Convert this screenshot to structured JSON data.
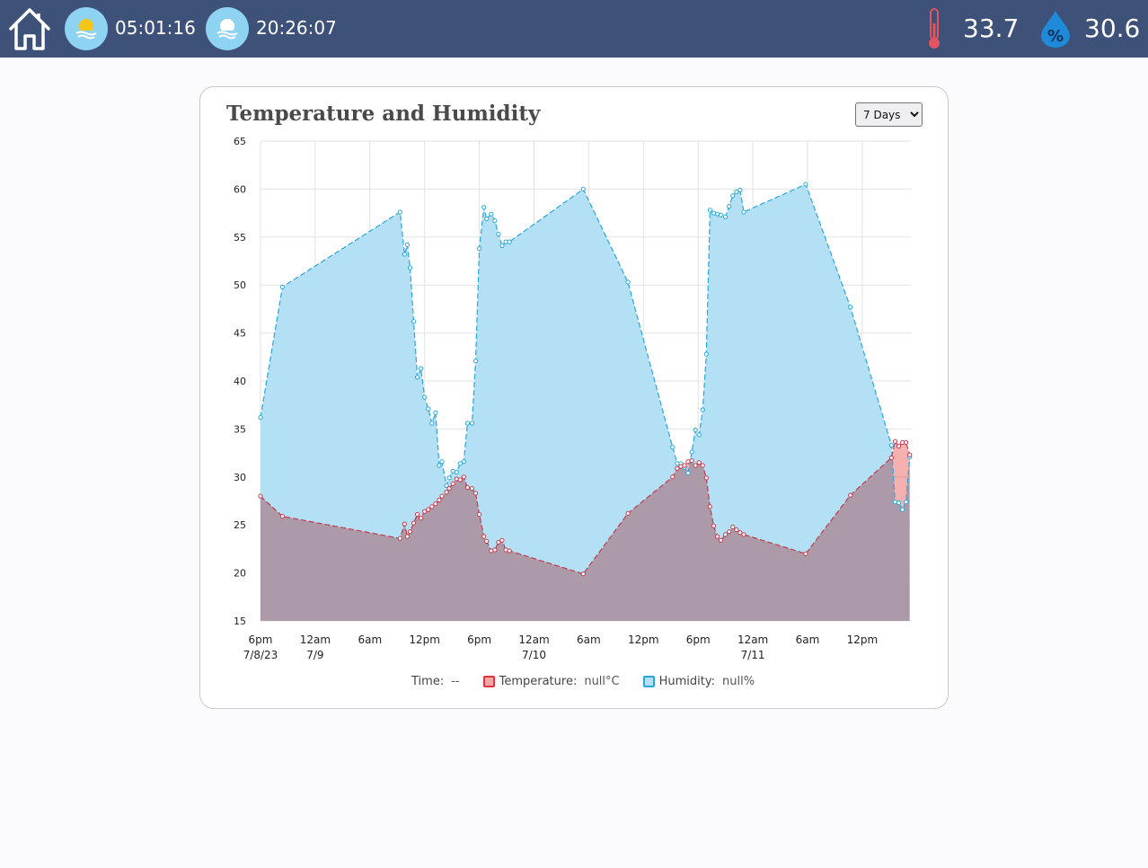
{
  "header": {
    "sunrise_time": "05:01:16",
    "sunset_time": "20:26:07",
    "temperature": "33.7",
    "humidity": "30.6",
    "colors": {
      "bar": "#3e5179",
      "sun_badge": "#8fd3f2",
      "thermometer": "#e05560",
      "drop": "#1e8ad8"
    },
    "icons": [
      "home-icon",
      "sunrise-icon",
      "sunset-icon",
      "thermometer-icon",
      "humidity-drop-icon"
    ]
  },
  "card": {
    "title": "Temperature and Humidity",
    "range_select": {
      "value": "7 Days"
    }
  },
  "legend": {
    "time_label": "Time:",
    "time_value": "--",
    "temperature_label": "Temperature:",
    "temperature_value": "null°C",
    "humidity_label": "Humidity:",
    "humidity_value": "null%"
  },
  "chart_data": {
    "type": "area",
    "title": "",
    "ylim": [
      15,
      65
    ],
    "yticks": [
      15,
      20,
      25,
      30,
      35,
      40,
      45,
      50,
      55,
      60,
      65
    ],
    "xlim": [
      18,
      77.7
    ],
    "x_unit": "hours from 12am 7/8/23",
    "x_ticks": [
      {
        "x": 18,
        "label": "6pm",
        "sub": "7/8/23"
      },
      {
        "x": 24,
        "label": "12am",
        "sub": "7/9"
      },
      {
        "x": 30,
        "label": "6am",
        "sub": ""
      },
      {
        "x": 36,
        "label": "12pm",
        "sub": ""
      },
      {
        "x": 42,
        "label": "6pm",
        "sub": ""
      },
      {
        "x": 48,
        "label": "12am",
        "sub": "7/10"
      },
      {
        "x": 54,
        "label": "6am",
        "sub": ""
      },
      {
        "x": 60,
        "label": "12pm",
        "sub": ""
      },
      {
        "x": 66,
        "label": "6pm",
        "sub": ""
      },
      {
        "x": 72,
        "label": "12am",
        "sub": "7/11"
      },
      {
        "x": 78,
        "label": "6am",
        "sub": ""
      },
      {
        "x": 84,
        "label": "12pm",
        "sub": ""
      }
    ],
    "grid": true,
    "series": [
      {
        "name": "Humidity",
        "color": "#29a7dc",
        "fill": "#b3e0f4",
        "points": [
          [
            18.0,
            36.2
          ],
          [
            20.4,
            49.8
          ],
          [
            33.3,
            57.6
          ],
          [
            33.8,
            53.2
          ],
          [
            34.1,
            54.2
          ],
          [
            34.4,
            51.8
          ],
          [
            34.8,
            46.2
          ],
          [
            35.2,
            40.4
          ],
          [
            35.6,
            41.3
          ],
          [
            36.0,
            38.3
          ],
          [
            36.4,
            37.1
          ],
          [
            36.8,
            35.6
          ],
          [
            37.2,
            36.7
          ],
          [
            37.6,
            31.2
          ],
          [
            37.9,
            31.6
          ],
          [
            38.4,
            29.1
          ],
          [
            38.7,
            29.9
          ],
          [
            39.1,
            30.6
          ],
          [
            39.5,
            30.5
          ],
          [
            39.9,
            31.4
          ],
          [
            40.3,
            31.6
          ],
          [
            40.7,
            35.6
          ],
          [
            41.2,
            35.6
          ],
          [
            41.6,
            42.1
          ],
          [
            42.0,
            53.8
          ],
          [
            42.5,
            58.1
          ],
          [
            42.8,
            56.9
          ],
          [
            43.3,
            57.4
          ],
          [
            43.7,
            56.7
          ],
          [
            44.1,
            55.3
          ],
          [
            44.5,
            54.1
          ],
          [
            44.9,
            54.5
          ],
          [
            45.3,
            54.5
          ],
          [
            53.4,
            60.0
          ],
          [
            58.3,
            50.3
          ],
          [
            63.2,
            33.1
          ],
          [
            63.7,
            31.4
          ],
          [
            64.1,
            31.4
          ],
          [
            64.5,
            31.0
          ],
          [
            64.9,
            30.4
          ],
          [
            65.3,
            32.6
          ],
          [
            65.7,
            34.9
          ],
          [
            66.1,
            34.4
          ],
          [
            66.5,
            37.0
          ],
          [
            66.9,
            42.8
          ],
          [
            67.3,
            57.8
          ],
          [
            67.7,
            57.5
          ],
          [
            68.1,
            57.4
          ],
          [
            68.5,
            57.3
          ],
          [
            69.0,
            57.1
          ],
          [
            69.4,
            58.2
          ],
          [
            69.8,
            59.3
          ],
          [
            70.2,
            59.7
          ],
          [
            70.6,
            59.9
          ],
          [
            71.0,
            57.6
          ],
          [
            77.8,
            60.5
          ],
          [
            82.7,
            47.7
          ],
          [
            87.2,
            33.3
          ],
          [
            87.6,
            27.4
          ],
          [
            88.0,
            27.3
          ],
          [
            88.4,
            26.6
          ],
          [
            88.8,
            27.4
          ],
          [
            89.2,
            32.1
          ]
        ]
      },
      {
        "name": "Temperature",
        "color": "#c23a4e",
        "fill": "#f6a5a5",
        "points": [
          [
            18.0,
            28.0
          ],
          [
            20.4,
            25.9
          ],
          [
            33.3,
            23.6
          ],
          [
            33.8,
            25.1
          ],
          [
            34.1,
            23.8
          ],
          [
            34.4,
            24.3
          ],
          [
            34.8,
            25.2
          ],
          [
            35.2,
            26.1
          ],
          [
            35.6,
            25.7
          ],
          [
            36.0,
            26.4
          ],
          [
            36.4,
            26.6
          ],
          [
            36.8,
            26.9
          ],
          [
            37.2,
            27.2
          ],
          [
            37.6,
            27.6
          ],
          [
            37.9,
            28.0
          ],
          [
            38.4,
            28.4
          ],
          [
            38.7,
            28.8
          ],
          [
            39.1,
            29.3
          ],
          [
            39.5,
            29.8
          ],
          [
            39.9,
            29.7
          ],
          [
            40.3,
            30.0
          ],
          [
            40.7,
            28.9
          ],
          [
            41.2,
            28.8
          ],
          [
            41.6,
            28.3
          ],
          [
            42.0,
            26.1
          ],
          [
            42.5,
            23.8
          ],
          [
            42.8,
            23.3
          ],
          [
            43.3,
            22.3
          ],
          [
            43.7,
            22.4
          ],
          [
            44.1,
            23.2
          ],
          [
            44.5,
            23.4
          ],
          [
            44.9,
            22.4
          ],
          [
            45.3,
            22.3
          ],
          [
            53.4,
            19.9
          ],
          [
            58.3,
            26.2
          ],
          [
            63.2,
            30.0
          ],
          [
            63.7,
            30.9
          ],
          [
            64.1,
            31.1
          ],
          [
            64.5,
            31.2
          ],
          [
            64.9,
            31.6
          ],
          [
            65.3,
            31.7
          ],
          [
            65.7,
            31.2
          ],
          [
            66.1,
            31.5
          ],
          [
            66.5,
            31.2
          ],
          [
            66.9,
            29.9
          ],
          [
            67.3,
            26.9
          ],
          [
            67.7,
            24.9
          ],
          [
            68.1,
            23.8
          ],
          [
            68.5,
            23.4
          ],
          [
            69.0,
            24.0
          ],
          [
            69.4,
            24.3
          ],
          [
            69.8,
            24.8
          ],
          [
            70.2,
            24.5
          ],
          [
            70.6,
            24.2
          ],
          [
            71.0,
            24.0
          ],
          [
            77.8,
            22.0
          ],
          [
            82.7,
            28.1
          ],
          [
            87.2,
            32.0
          ],
          [
            87.6,
            33.7
          ],
          [
            88.0,
            33.2
          ],
          [
            88.4,
            33.6
          ],
          [
            88.8,
            33.6
          ],
          [
            89.2,
            32.3
          ]
        ]
      }
    ]
  }
}
